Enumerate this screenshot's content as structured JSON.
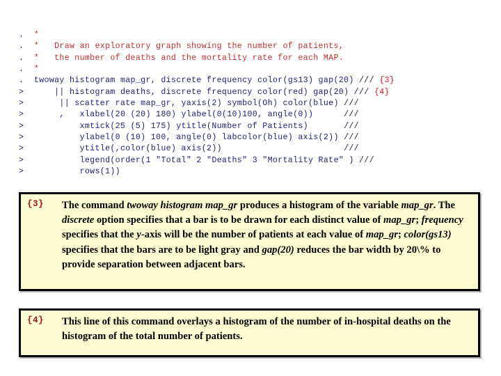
{
  "code_listing": {
    "lines": [
      {
        "prompt": ".",
        "indent": 2,
        "kind": "comment",
        "text": "*"
      },
      {
        "prompt": ".",
        "indent": 2,
        "kind": "comment",
        "text": "*   Draw an exploratory graph showing the number of patients,"
      },
      {
        "prompt": ".",
        "indent": 2,
        "kind": "comment",
        "text": "*   the number of deaths and the mortality rate for each MAP."
      },
      {
        "prompt": ".",
        "indent": 2,
        "kind": "comment",
        "text": "*"
      },
      {
        "prompt": ".",
        "indent": 2,
        "kind": "code",
        "text": "twoway histogram map_gr, discrete frequency color(gs13) gap(20)",
        "slashes": "///",
        "ref": "{3}"
      },
      {
        "prompt": ">",
        "indent": 6,
        "kind": "code",
        "text": "|| histogram deaths, discrete frequency color(red) gap(20)",
        "slashes": "///",
        "ref": "{4}"
      },
      {
        "prompt": ">",
        "indent": 7,
        "kind": "code",
        "text": "|| scatter rate map_gr, yaxis(2) symbol(Oh) color(blue)",
        "slashes": "///",
        "ref": ""
      },
      {
        "prompt": ">",
        "indent": 7,
        "kind": "code",
        "text": ",   xlabel(20 (20) 180) ylabel(0(10)100, angle(0))",
        "slashes": "///",
        "ref": ""
      },
      {
        "prompt": ">",
        "indent": 11,
        "kind": "code",
        "text": "xmtick(25 (5) 175) ytitle(Number of Patients)",
        "slashes": "///",
        "ref": ""
      },
      {
        "prompt": ">",
        "indent": 11,
        "kind": "code",
        "text": "ylabel(0 (10) 100, angle(0) labcolor(blue) axis(2))",
        "slashes": "///",
        "ref": ""
      },
      {
        "prompt": ">",
        "indent": 11,
        "kind": "code",
        "text": "ytitle(,color(blue) axis(2))",
        "slashes": "///",
        "ref": ""
      },
      {
        "prompt": ">",
        "indent": 11,
        "kind": "code",
        "text": "legend(order(1 \"Total\" 2 \"Deaths\" 3 \"Mortality Rate\" )",
        "slashes": "///",
        "ref": ""
      },
      {
        "prompt": ">",
        "indent": 11,
        "kind": "code",
        "text": "rows(1))",
        "slashes": "",
        "ref": ""
      }
    ]
  },
  "notes": [
    {
      "marker": "{3}",
      "full_text": "The command twoway histogram map_gr produces a histogram of the variable map_gr. The discrete option specifies that a bar is to be drawn for each distinct value of map_gr; frequency specifies that the y-axis will be the number of patients at each value of map_gr; color(gs13) specifies that the bars are to be light gray and gap(20) reduces the bar width by 20\\% to provide separation between adjacent bars.",
      "segments": [
        {
          "t": "The command ",
          "style": "bold"
        },
        {
          "t": "twoway histogram map_gr",
          "style": "italic"
        },
        {
          "t": " produces a histogram of the variable ",
          "style": "bold"
        },
        {
          "t": "map_gr",
          "style": "italic"
        },
        {
          "t": ". The ",
          "style": "bold"
        },
        {
          "t": "discrete",
          "style": "italic"
        },
        {
          "t": " option specifies that a bar is to be drawn for each distinct value of ",
          "style": "bold"
        },
        {
          "t": "map_gr",
          "style": "italic"
        },
        {
          "t": "; ",
          "style": "bold"
        },
        {
          "t": "frequency",
          "style": "italic"
        },
        {
          "t": " specifies that the ",
          "style": "bold"
        },
        {
          "t": "y",
          "style": "italic"
        },
        {
          "t": "-axis will be the number of patients at each value of ",
          "style": "bold"
        },
        {
          "t": "map_gr",
          "style": "italic"
        },
        {
          "t": "; ",
          "style": "bold"
        },
        {
          "t": "color(gs13)",
          "style": "italic"
        },
        {
          "t": " specifies that the bars are to be light gray and ",
          "style": "bold"
        },
        {
          "t": "gap(20)",
          "style": "italic"
        },
        {
          "t": " reduces the bar width by 20\\% to provide separation between adjacent bars.",
          "style": "bold"
        }
      ]
    },
    {
      "marker": "{4}",
      "full_text": "This line of this command overlays a histogram of the number of in-hospital deaths on the histogram of the total number of patients.",
      "segments": [
        {
          "t": "This line of this command overlays a histogram of the number of in-hospital deaths on the histogram of the total number of patients.",
          "style": "bold"
        }
      ]
    }
  ],
  "colors": {
    "comment": "#c03030",
    "code": "#1f1f7a",
    "reference": "#cc2222",
    "note_background": "#fdfbd2",
    "note_border": "#000000",
    "note_marker": "#a01818",
    "page_background": "#ffffff"
  }
}
